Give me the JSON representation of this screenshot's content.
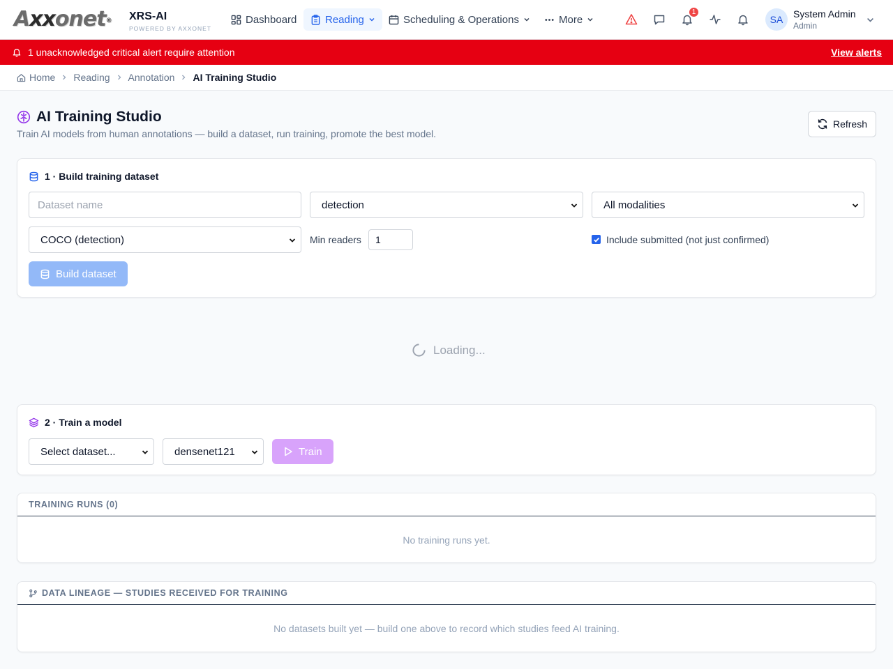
{
  "header": {
    "logo_text": "Axxonet",
    "app_name": "XRS-AI",
    "powered_by": "POWERED BY AXXONET",
    "nav": [
      {
        "label": "Dashboard"
      },
      {
        "label": "Reading"
      },
      {
        "label": "Scheduling & Operations"
      },
      {
        "label": "More"
      }
    ],
    "notification_count": "1",
    "user": {
      "initials": "SA",
      "name": "System Admin",
      "role": "Admin"
    }
  },
  "alert": {
    "message": "1 unacknowledged critical alert require attention",
    "link": "View alerts",
    "color": "#e60012"
  },
  "breadcrumb": [
    "Home",
    "Reading",
    "Annotation",
    "AI Training Studio"
  ],
  "page": {
    "title": "AI Training Studio",
    "subtitle": "Train AI models from human annotations — build a dataset, run training, promote the best model.",
    "refresh_label": "Refresh"
  },
  "build": {
    "heading": "1 · Build training dataset",
    "dataset_name_placeholder": "Dataset name",
    "task_type": "detection",
    "modality": "All modalities",
    "format": "COCO (detection)",
    "min_readers_label": "Min readers",
    "min_readers_value": "1",
    "include_submitted_label": "Include submitted (not just confirmed)",
    "include_submitted_checked": true,
    "build_button": "Build dataset"
  },
  "loading_text": "Loading...",
  "train": {
    "heading": "2 · Train a model",
    "dataset_select": "Select dataset...",
    "architecture": "densenet121",
    "train_button": "Train"
  },
  "runs": {
    "heading": "TRAINING RUNS (0)",
    "empty": "No training runs yet."
  },
  "lineage": {
    "heading": "DATA LINEAGE — STUDIES RECEIVED FOR TRAINING",
    "empty": "No datasets built yet — build one above to record which studies feed AI training."
  }
}
